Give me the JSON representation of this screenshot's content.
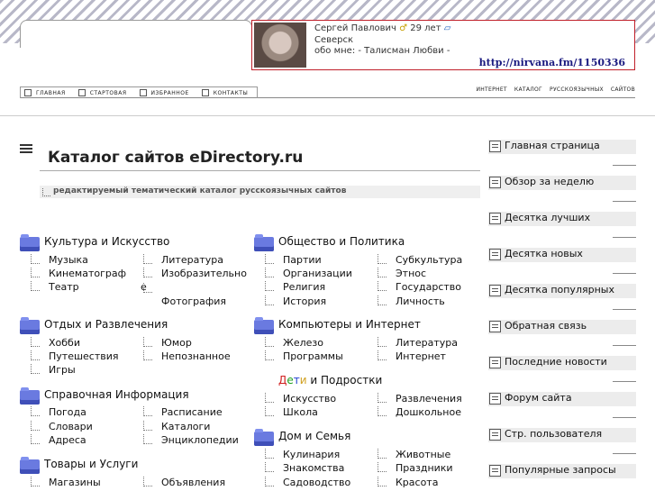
{
  "profile": {
    "name": "Сергей Павлович",
    "age": "29 лет",
    "city": "Северск",
    "about": "обо мне: - Талисман Любви -",
    "url": "http://nirvana.fm/1150336"
  },
  "nav": {
    "left": [
      {
        "icon": "home-icon",
        "label": "ГЛАВНАЯ"
      },
      {
        "icon": "page-icon",
        "label": "СТАРТОВАЯ"
      },
      {
        "icon": "star-icon",
        "label": "ИЗБРАННОЕ"
      },
      {
        "icon": "contacts-icon",
        "label": "КОНТАКТЫ"
      }
    ],
    "right": [
      "ИНТЕРНЕТ",
      "КАТАЛОГ",
      "РУССКОЯЗЫЧНЫХ",
      "САЙТОВ"
    ]
  },
  "page": {
    "title": "Каталог сайтов eDirectory.ru",
    "subtitle": "редактируемый тематический каталог русскоязычных сайтов"
  },
  "categories": {
    "culture": {
      "title": "Культура и Искусство",
      "items": [
        "Музыка",
        "Литература",
        "Кинематограф",
        "Изобразительно",
        "Театр",
        "е",
        "Фотография"
      ]
    },
    "leisure": {
      "title": "Отдых и Развлечения",
      "items": [
        "Хобби",
        "Юмор",
        "Путешествия",
        "Непознанное",
        "Игры"
      ]
    },
    "reference": {
      "title": "Справочная Информация",
      "items": [
        "Погода",
        "Расписание",
        "Словари",
        "Каталоги",
        "Адреса",
        "Энциклопедии"
      ]
    },
    "goods": {
      "title": "Товары и Услуги",
      "items": [
        "Магазины",
        "Объявления"
      ]
    },
    "society": {
      "title": "Общество и Политика",
      "items": [
        "Партии",
        "Субкультура",
        "Организации",
        "Этнос",
        "Религия",
        "Государство",
        "История",
        "Личность"
      ]
    },
    "computers": {
      "title": "Компьютеры и Интернет",
      "items": [
        "Железо",
        "Литература",
        "Программы",
        "Интернет"
      ]
    },
    "kids": {
      "title_parts": [
        "Д",
        "е",
        "т",
        "и",
        " и Подростки"
      ],
      "items": [
        "Искусство",
        "Развлечения",
        "Школа",
        "Дошкольное"
      ]
    },
    "home": {
      "title": "Дом и Семья",
      "items": [
        "Кулинария",
        "Животные",
        "Знакомства",
        "Праздники",
        "Садоводство",
        "Красота"
      ]
    }
  },
  "sidebar": {
    "items": [
      {
        "icon": "home-icon",
        "label": "Главная страница"
      },
      {
        "icon": "week-icon",
        "label": "Обзор за неделю"
      },
      {
        "icon": "top-icon",
        "label": "Десятка лучших"
      },
      {
        "icon": "new-icon",
        "label": "Десятка новых"
      },
      {
        "icon": "popular-icon",
        "label": "Десятка популярных"
      },
      {
        "icon": "feedback-icon",
        "label": "Обратная связь"
      },
      {
        "icon": "news-icon",
        "label": "Последние новости"
      },
      {
        "icon": "forum-icon",
        "label": "Форум сайта"
      },
      {
        "icon": "user-icon",
        "label": "Стр. пользователя"
      },
      {
        "icon": "search-icon",
        "label": "Популярные запросы"
      }
    ]
  }
}
